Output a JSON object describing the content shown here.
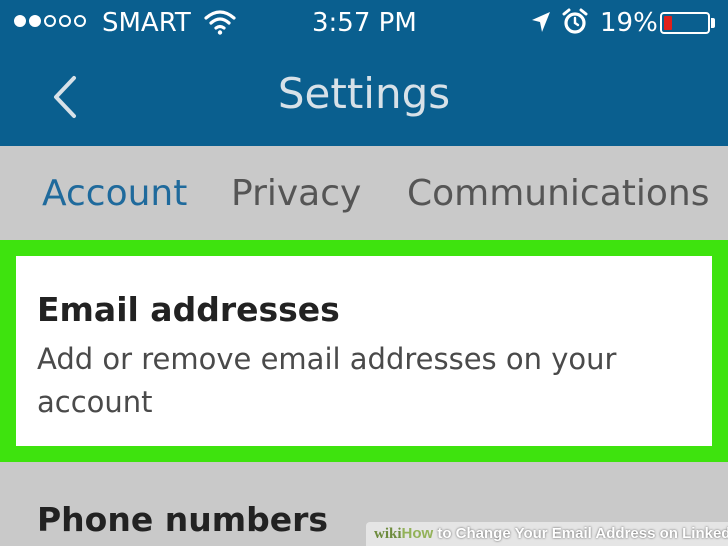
{
  "status_bar": {
    "carrier": "SMART",
    "signal_bars_filled": 2,
    "signal_bars_total": 5,
    "time": "3:57 PM",
    "battery": "19%",
    "battery_level": 0.19,
    "battery_color": "#e0201b",
    "icons": [
      "wifi-icon",
      "location-arrow-icon",
      "alarm-clock-icon",
      "battery-icon"
    ]
  },
  "nav": {
    "title": "Settings",
    "back_icon": "chevron-left-icon"
  },
  "tabs": [
    {
      "label": "Account",
      "active": true
    },
    {
      "label": "Privacy",
      "active": false
    },
    {
      "label": "Communications",
      "active": false
    }
  ],
  "settings": [
    {
      "title": "Email addresses",
      "description": "Add or remove email addresses on your account",
      "highlighted": true
    },
    {
      "title": "Phone numbers"
    }
  ],
  "watermark": {
    "logo": "wiki",
    "how": "How",
    "rest": " to Change Your Email Address on Linkedin"
  },
  "colors": {
    "header": "#0a5f8f",
    "active_tab": "#1f6a9c",
    "highlight": "#3ee30e"
  }
}
